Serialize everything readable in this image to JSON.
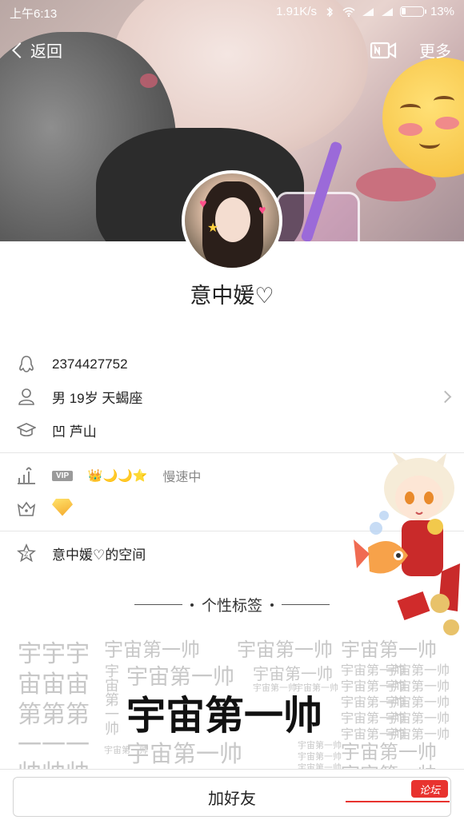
{
  "status_bar": {
    "time": "上午6:13",
    "net_speed": "1.91K/s",
    "battery": "13%"
  },
  "nav": {
    "back_label": "返回",
    "more_label": "更多"
  },
  "profile": {
    "name": "意中媛♡",
    "qq": "2374427752",
    "gender_age_sign": "男  19岁  天蝎座",
    "location": "凹 芦山",
    "vip_badge": "VIP",
    "level_icons": "👑🌙🌙⭐",
    "speed_text": "慢速中",
    "space_label": "意中媛♡的空间"
  },
  "tags": {
    "title": "个性标签",
    "featured": "宇宙第一帅",
    "repeated_chars": [
      "宇宇宇",
      "宙宙宙",
      "第第第",
      "一一一",
      "帅帅帅"
    ]
  },
  "bottom": {
    "add_friend_label": "加好友",
    "watermark": "论坛"
  },
  "colors": {
    "accent_red": "#e8332f",
    "divider": "#e6e6e6",
    "tag_grey": "#c8c8c8"
  },
  "icons": {
    "qq": "penguin-icon",
    "person": "person-icon",
    "school": "graduation-cap-icon",
    "level": "level-chart-icon",
    "crown": "crown-icon",
    "space": "space-star-icon",
    "video": "video-call-icon"
  }
}
